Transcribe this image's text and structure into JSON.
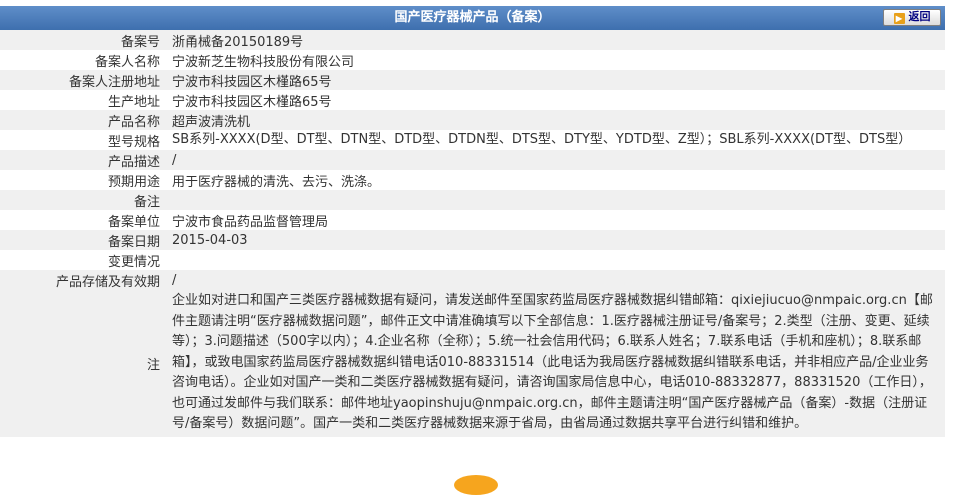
{
  "header": {
    "title": "国产医疗器械产品（备案）",
    "back_label": "返回"
  },
  "rows": [
    {
      "label": "备案号",
      "value": "浙甬械备20150189号"
    },
    {
      "label": "备案人名称",
      "value": "宁波新芝生物科技股份有限公司"
    },
    {
      "label": "备案人注册地址",
      "value": "宁波市科技园区木槿路65号"
    },
    {
      "label": "生产地址",
      "value": "宁波市科技园区木槿路65号"
    },
    {
      "label": "产品名称",
      "value": "超声波清洗机"
    },
    {
      "label": "型号规格",
      "value": "SB系列-XXXX(D型、DT型、DTN型、DTD型、DTDN型、DTS型、DTY型、YDTD型、Z型）；SBL系列-XXXX(DT型、DTS型）"
    },
    {
      "label": "产品描述",
      "value": "/"
    },
    {
      "label": "预期用途",
      "value": "用于医疗器械的清洗、去污、洗涤。"
    },
    {
      "label": "备注",
      "value": ""
    },
    {
      "label": "备案单位",
      "value": "宁波市食品药品监督管理局"
    },
    {
      "label": "备案日期",
      "value": "2015-04-03"
    },
    {
      "label": "变更情况",
      "value": ""
    },
    {
      "label": "产品存储及有效期",
      "value": "/"
    }
  ],
  "note": {
    "label": "注",
    "text": "企业如对进口和国产三类医疗器械数据有疑问，请发送邮件至国家药监局医疗器械数据纠错邮箱：qixiejiucuo@nmpaic.org.cn【邮件主题请注明“医疗器械数据问题”，邮件正文中请准确填写以下全部信息：1.医疗器械注册证号/备案号；2.类型（注册、变更、延续等）；3.问题描述（500字以内）；4.企业名称（全称）；5.统一社会信用代码；6.联系人姓名；7.联系电话（手机和座机）；8.联系邮箱】，或致电国家药监局医疗器械数据纠错电话010-88331514（此电话为我局医疗器械数据纠错联系电话，并非相应产品/企业业务咨询电话）。企业如对国产一类和二类医疗器械数据有疑问，请咨询国家局信息中心，电话010-88332877，88331520（工作日），也可通过发邮件与我们联系：邮件地址yaopinshuju@nmpaic.org.cn，邮件主题请注明“国产医疗器械产品（备案）-数据（注册证号/备案号）数据问题”。国产一类和二类医疗器械数据来源于省局，由省局通过数据共享平台进行纠错和维护。"
  },
  "colors": {
    "header_bg": "#4a7bbd",
    "row_alt": "#f0f0f0",
    "back_arrow": "#e8a019"
  }
}
